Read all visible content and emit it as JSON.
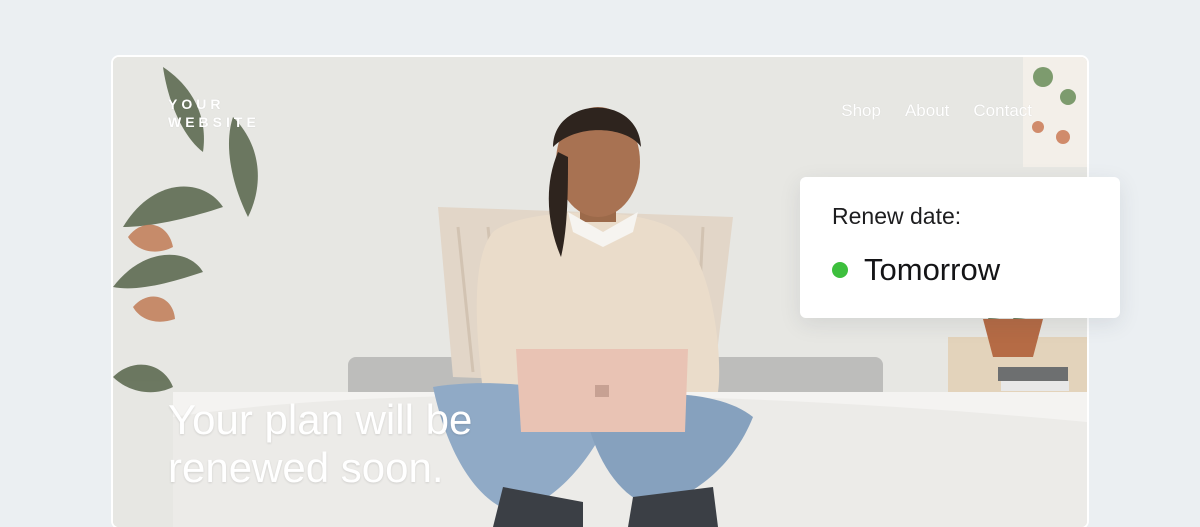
{
  "site": {
    "logo_text": "YOUR\nWEBSITE",
    "nav": [
      "Shop",
      "About",
      "Contact"
    ],
    "headline": "Your plan will be renewed soon."
  },
  "renewal": {
    "label": "Renew date:",
    "value": "Tomorrow",
    "status_color": "#3dbf3d"
  },
  "colors": {
    "page_background": "#ebeff2",
    "card_background": "#ffffff"
  }
}
